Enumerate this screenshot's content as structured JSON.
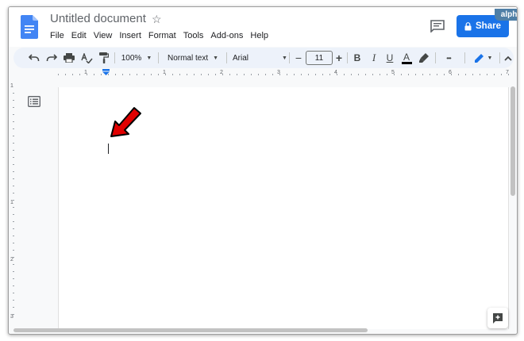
{
  "header": {
    "doc_title": "Untitled document",
    "menu": [
      "File",
      "Edit",
      "View",
      "Insert",
      "Format",
      "Tools",
      "Add-ons",
      "Help"
    ],
    "share_label": "Share"
  },
  "watermark": "alphr",
  "toolbar": {
    "zoom": "100%",
    "style": "Normal text",
    "font": "Arial",
    "font_size": "11",
    "more_glyph": "•••"
  },
  "ruler": {
    "h_labels": [
      "1",
      "1",
      "2",
      "3",
      "4",
      "5",
      "6",
      "7"
    ],
    "v_labels": [
      "1",
      "1",
      "2",
      "3"
    ]
  },
  "colors": {
    "share_bg": "#1a73e8",
    "doc_icon": "#4285f4",
    "arrow": "#e00000",
    "toolbar_bg": "#edf2fa"
  }
}
